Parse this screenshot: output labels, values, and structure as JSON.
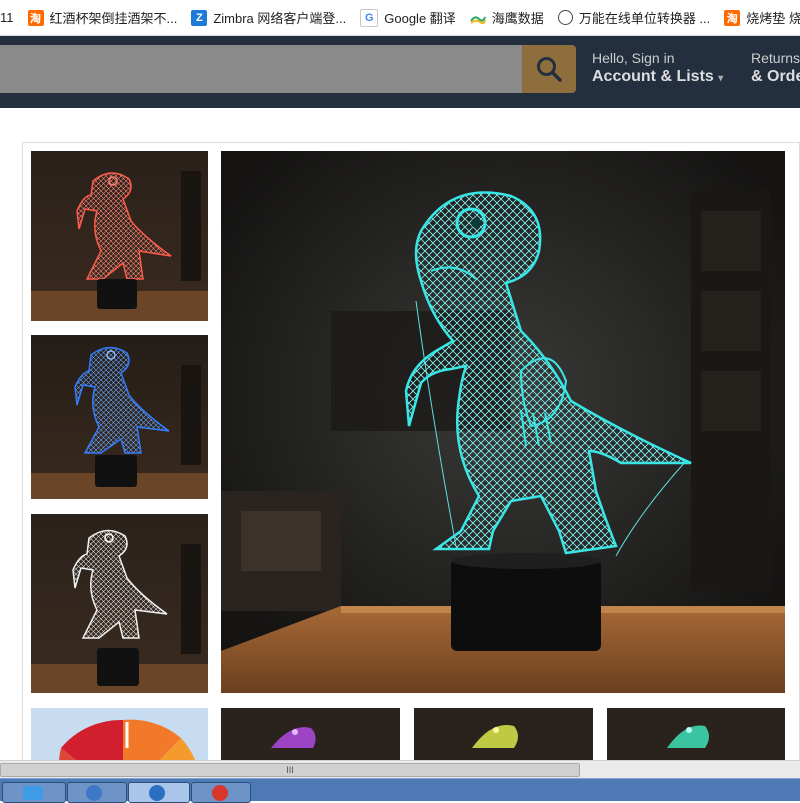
{
  "bookmarks": [
    {
      "label": "11",
      "icon": "none"
    },
    {
      "label": "红酒杯架倒挂酒架不...",
      "icon": "taobao-icon"
    },
    {
      "label": "Zimbra 网络客户端登...",
      "icon": "zimbra-icon"
    },
    {
      "label": "Google 翻译",
      "icon": "google-translate-icon"
    },
    {
      "label": "海鹰数据",
      "icon": "seaeagle-icon"
    },
    {
      "label": "万能在线单位转换器 ...",
      "icon": "globe-icon"
    },
    {
      "label": "烧烤垫 烧烤网格垫",
      "icon": "taobao-icon"
    }
  ],
  "header": {
    "search_placeholder": "",
    "account_greeting": "Hello, Sign in",
    "account_label": "Account & Lists",
    "returns_line1": "Returns",
    "returns_line2": "& Orders"
  },
  "gallery": {
    "thumbnails": [
      {
        "color": "#ff5a4a",
        "label": "red-dinosaur-lamp"
      },
      {
        "color": "#2f7cff",
        "label": "blue-dinosaur-lamp"
      },
      {
        "color": "#f0f0f0",
        "label": "white-dinosaur-lamp"
      },
      {
        "color": "multicolor",
        "label": "color-wheel"
      }
    ],
    "bottom_thumbnails": [
      {
        "color": "#b04ae0"
      },
      {
        "color": "#d8e84a"
      },
      {
        "color": "#3fe0b8"
      }
    ],
    "main_color": "#39e6e6"
  },
  "scrollbar": {
    "grip": "III"
  },
  "colors": {
    "amazon_dark": "#232f3e",
    "search_button": "#8e6e3d"
  }
}
